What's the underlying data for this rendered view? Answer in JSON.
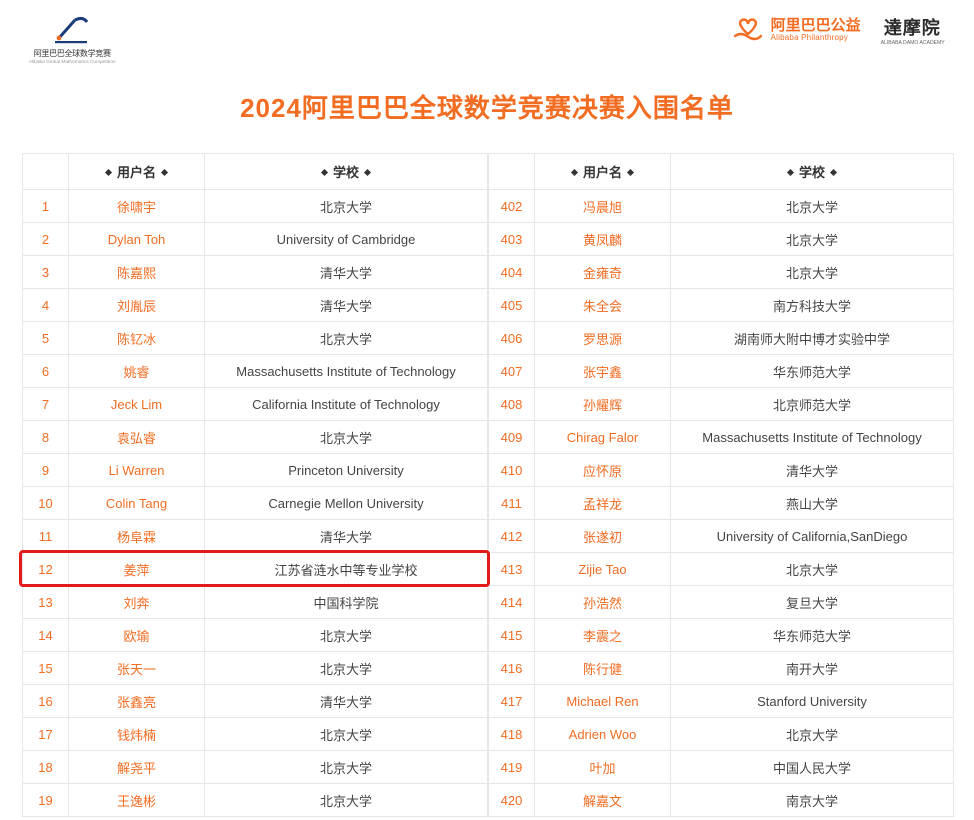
{
  "logos": {
    "left_cn": "阿里巴巴全球数学竞赛",
    "left_en": "Alibaba Global Mathematics Competition",
    "phil_cn": "阿里巴巴公益",
    "phil_en": "Alibaba Philanthropy",
    "damo_cn": "達摩院",
    "damo_en": "ALIBABA DAMO ACADEMY"
  },
  "title": "2024阿里巴巴全球数学竞赛决赛入围名单",
  "columns": {
    "user": "用户名",
    "school": "学校"
  },
  "left_rows": [
    {
      "rank": "1",
      "user": "徐啸宇",
      "school": "北京大学"
    },
    {
      "rank": "2",
      "user": "Dylan Toh",
      "school": "University of Cambridge"
    },
    {
      "rank": "3",
      "user": "陈嘉熙",
      "school": "清华大学"
    },
    {
      "rank": "4",
      "user": "刘胤辰",
      "school": "清华大学"
    },
    {
      "rank": "5",
      "user": "陈钇冰",
      "school": "北京大学"
    },
    {
      "rank": "6",
      "user": "姚睿",
      "school": "Massachusetts Institute of Technology"
    },
    {
      "rank": "7",
      "user": "Jeck Lim",
      "school": "California Institute of Technology"
    },
    {
      "rank": "8",
      "user": "袁弘睿",
      "school": "北京大学"
    },
    {
      "rank": "9",
      "user": "Li Warren",
      "school": "Princeton University"
    },
    {
      "rank": "10",
      "user": "Colin Tang",
      "school": "Carnegie Mellon University"
    },
    {
      "rank": "11",
      "user": "杨阜霖",
      "school": "清华大学"
    },
    {
      "rank": "12",
      "user": "姜萍",
      "school": "江苏省涟水中等专业学校"
    },
    {
      "rank": "13",
      "user": "刘奔",
      "school": "中国科学院"
    },
    {
      "rank": "14",
      "user": "欧瑜",
      "school": "北京大学"
    },
    {
      "rank": "15",
      "user": "张天一",
      "school": "北京大学"
    },
    {
      "rank": "16",
      "user": "张鑫亮",
      "school": "清华大学"
    },
    {
      "rank": "17",
      "user": "钱炜楠",
      "school": "北京大学"
    },
    {
      "rank": "18",
      "user": "解尧平",
      "school": "北京大学"
    },
    {
      "rank": "19",
      "user": "王逸彬",
      "school": "北京大学"
    }
  ],
  "right_rows": [
    {
      "rank": "402",
      "user": "冯晨旭",
      "school": "北京大学"
    },
    {
      "rank": "403",
      "user": "黄凤麟",
      "school": "北京大学"
    },
    {
      "rank": "404",
      "user": "金雍奇",
      "school": "北京大学"
    },
    {
      "rank": "405",
      "user": "朱全会",
      "school": "南方科技大学"
    },
    {
      "rank": "406",
      "user": "罗思源",
      "school": "湖南师大附中博才实验中学"
    },
    {
      "rank": "407",
      "user": "张宇鑫",
      "school": "华东师范大学"
    },
    {
      "rank": "408",
      "user": "孙耀辉",
      "school": "北京师范大学"
    },
    {
      "rank": "409",
      "user": "Chirag Falor",
      "school": "Massachusetts Institute of Technology"
    },
    {
      "rank": "410",
      "user": "应怀原",
      "school": "清华大学"
    },
    {
      "rank": "411",
      "user": "孟祥龙",
      "school": "燕山大学"
    },
    {
      "rank": "412",
      "user": "张遂初",
      "school": "University of California,SanDiego"
    },
    {
      "rank": "413",
      "user": "Zijie Tao",
      "school": "北京大学"
    },
    {
      "rank": "414",
      "user": "孙浩然",
      "school": "复旦大学"
    },
    {
      "rank": "415",
      "user": "李震之",
      "school": "华东师范大学"
    },
    {
      "rank": "416",
      "user": "陈行健",
      "school": "南开大学"
    },
    {
      "rank": "417",
      "user": "Michael Ren",
      "school": "Stanford University"
    },
    {
      "rank": "418",
      "user": "Adrien Woo",
      "school": "北京大学"
    },
    {
      "rank": "419",
      "user": "叶加",
      "school": "中国人民大学"
    },
    {
      "rank": "420",
      "user": "解嘉文",
      "school": "南京大学"
    }
  ],
  "highlight_row_index": 11
}
